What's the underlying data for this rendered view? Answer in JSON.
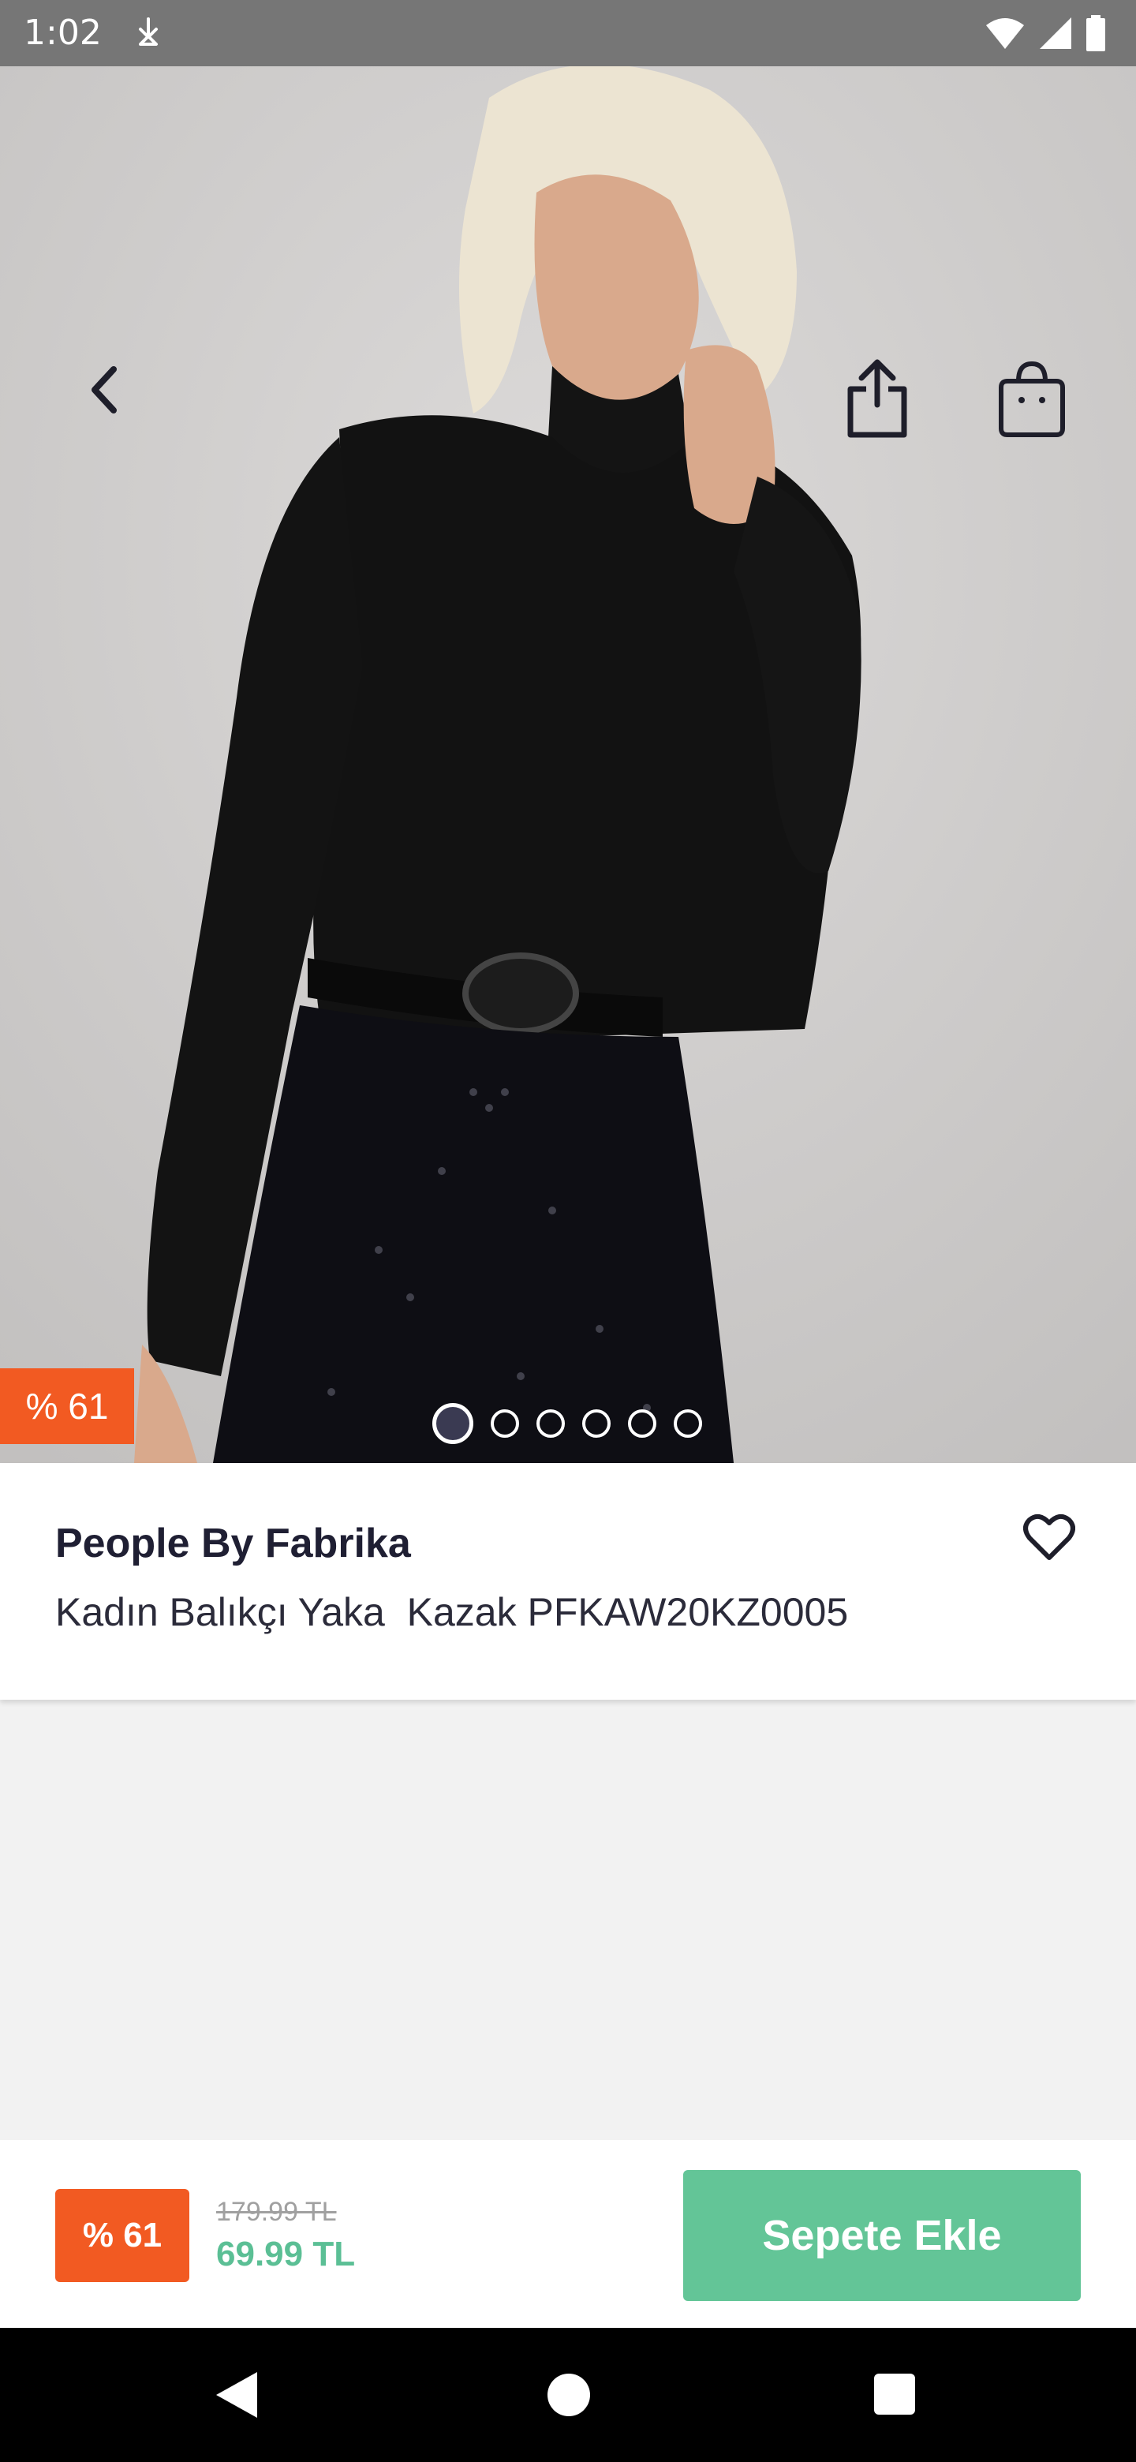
{
  "status_bar": {
    "time": "1:02",
    "icons": [
      "download-icon",
      "wifi-icon",
      "signal-icon",
      "battery-icon"
    ]
  },
  "header": {
    "back_icon": "chevron-left-icon",
    "share_icon": "share-icon",
    "bag_icon": "shopping-bag-icon"
  },
  "gallery": {
    "discount_badge": "% 61",
    "image_count": 6,
    "active_index": 0
  },
  "product": {
    "brand": "People By Fabrika",
    "name": "Kadın Balıkçı Yaka  Kazak PFKAW20KZ0005",
    "favorite_icon": "heart-outline-icon"
  },
  "purchase": {
    "discount_badge": "% 61",
    "old_price": "179.99 TL",
    "new_price": "69.99 TL",
    "add_to_cart_label": "Sepete Ekle"
  },
  "colors": {
    "accent_orange": "#f25a22",
    "accent_green": "#63c597",
    "price_green": "#5bbf95",
    "text_dark": "#1f1f33"
  },
  "navigation": {
    "icons": [
      "nav-back-icon",
      "nav-home-icon",
      "nav-recents-icon"
    ]
  }
}
